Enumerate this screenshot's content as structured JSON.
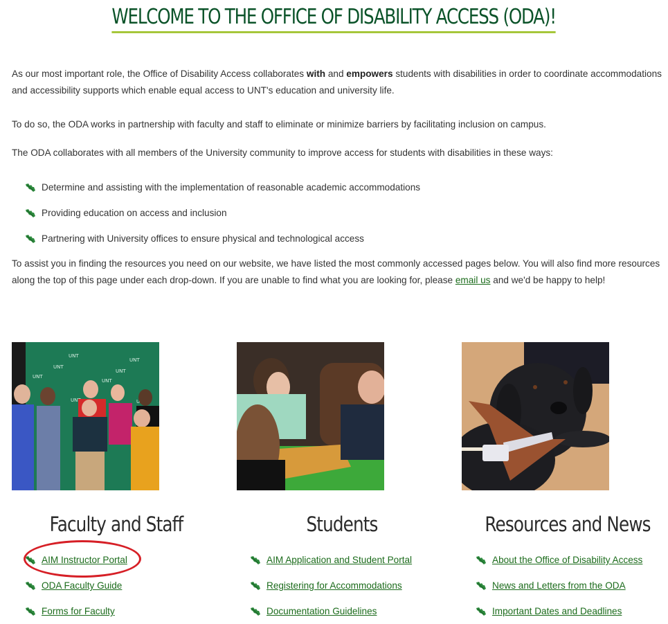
{
  "page": {
    "title": "WELCOME TO THE OFFICE OF DISABILITY ACCESS (ODA)!",
    "intro": {
      "part1": "As our most important role, the Office of Disability Access collaborates ",
      "bold1": "with",
      "part2": " and ",
      "bold2": "empowers",
      "part3": " students with disabilities in order to coordinate accommodations and accessibility supports which enable equal access to UNT's education and university life."
    },
    "para2": "To do so, the ODA works in partnership with faculty and staff to eliminate or minimize barriers by facilitating inclusion on campus.",
    "para3": "The ODA collaborates with all members of the University community to improve access for students with disabilities in these ways:",
    "bullets": [
      "Determine and assisting with the implementation of reasonable academic accommodations",
      "Providing education on access and inclusion",
      "Partnering with University offices to ensure physical and technological access"
    ],
    "para4": {
      "before": "To assist you in finding the resources you need on our website, we have listed the most commonly accessed pages below. You will also find more resources along the top of this page under each drop-down. If you are unable to find what you are looking for, please ",
      "link": "email us",
      "after": " and we'd be happy to help!"
    },
    "bullet_icon": "eagle-leaf-icon",
    "accent_color": "#0b5329",
    "underline_color": "#a6c73a",
    "link_color": "#1b6b1b",
    "highlight_color": "#d61f26"
  },
  "columns": [
    {
      "title": "Faculty and Staff",
      "image_alt": "Group of faculty and staff posing in front of a UNT backdrop",
      "links": [
        "AIM Instructor Portal",
        "ODA Faculty Guide",
        "Forms for Faculty"
      ]
    },
    {
      "title": "Students",
      "image_alt": "Students playing a board game at a green table",
      "links": [
        "AIM Application and Student Portal",
        "Registering for Accommodations",
        "Documentation Guidelines"
      ]
    },
    {
      "title": "Resources and News",
      "image_alt": "Black guide dog in a brown harness lying on a wooden floor",
      "links": [
        "About the Office of Disability Access",
        "News and Letters from the ODA",
        "Important Dates and Deadlines"
      ]
    }
  ]
}
